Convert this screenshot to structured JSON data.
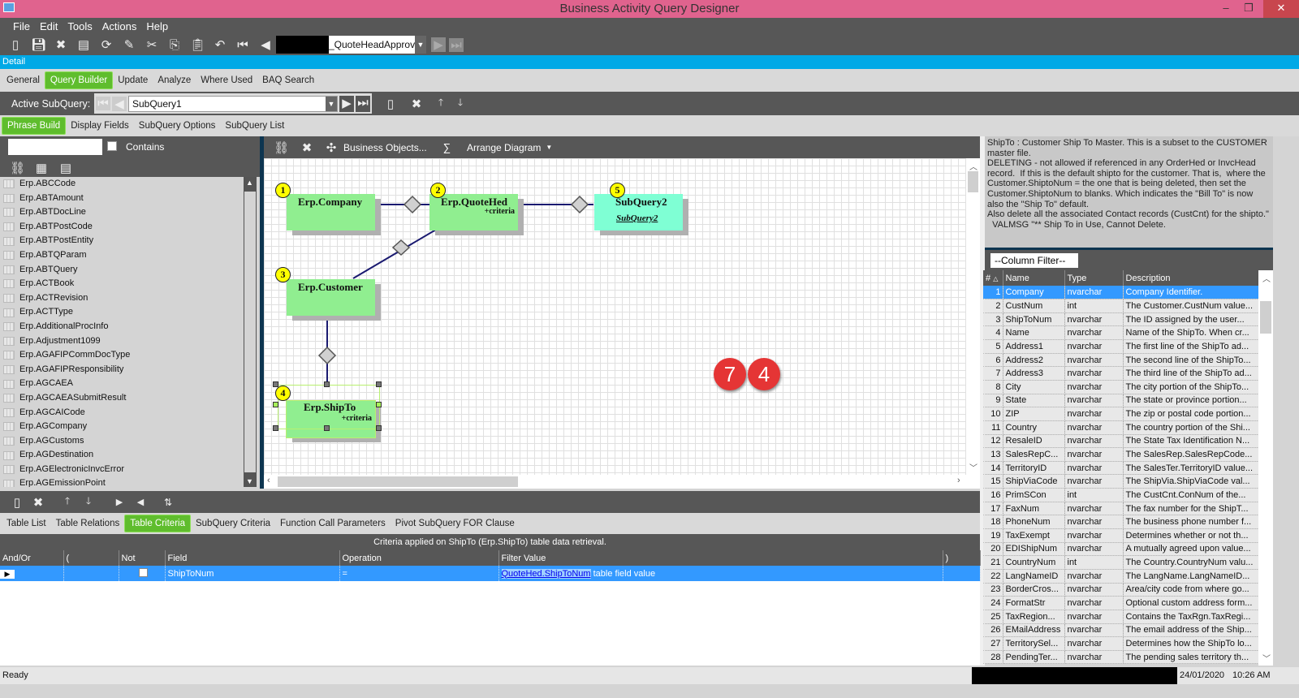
{
  "window": {
    "title": "Business Activity Query Designer"
  },
  "menu": [
    "File",
    "Edit",
    "Tools",
    "Actions",
    "Help"
  ],
  "toolbar": {
    "query_id_suffix": "_QuoteHeadApprov"
  },
  "detail_label": "Detail",
  "main_tabs": [
    {
      "label": "General"
    },
    {
      "label": "Query Builder",
      "active": true
    },
    {
      "label": "Update"
    },
    {
      "label": "Analyze"
    },
    {
      "label": "Where Used"
    },
    {
      "label": "BAQ Search"
    }
  ],
  "subquery": {
    "label": "Active SubQuery:",
    "value": "SubQuery1"
  },
  "sub_tabs": [
    {
      "label": "Phrase Build",
      "active": true
    },
    {
      "label": "Display Fields"
    },
    {
      "label": "SubQuery Options"
    },
    {
      "label": "SubQuery List"
    }
  ],
  "left_panel": {
    "search_value": "",
    "contains_label": "Contains",
    "contains_checked": false,
    "tables": [
      "Erp.ABCCode",
      "Erp.ABTAmount",
      "Erp.ABTDocLine",
      "Erp.ABTPostCode",
      "Erp.ABTPostEntity",
      "Erp.ABTQParam",
      "Erp.ABTQuery",
      "Erp.ACTBook",
      "Erp.ACTRevision",
      "Erp.ACTType",
      "Erp.AdditionalProcInfo",
      "Erp.Adjustment1099",
      "Erp.AGAFIPCommDocType",
      "Erp.AGAFIPResponsibility",
      "Erp.AGCAEA",
      "Erp.AGCAEASubmitResult",
      "Erp.AGCAICode",
      "Erp.AGCompany",
      "Erp.AGCustoms",
      "Erp.AGDestination",
      "Erp.AGElectronicInvcError",
      "Erp.AGEmissionPoint"
    ]
  },
  "diagram_toolbar": {
    "business_objects": "Business Objects...",
    "sigma": "∑",
    "arrange": "Arrange Diagram"
  },
  "diagram": {
    "nodes": [
      {
        "num": "1",
        "title": "Erp.Company",
        "criteria": "",
        "color": "#90ee90"
      },
      {
        "num": "2",
        "title": "Erp.QuoteHed",
        "criteria": "+criteria",
        "color": "#90ee90"
      },
      {
        "num": "5",
        "title": "SubQuery2",
        "subtitle": "SubQuery2",
        "color": "#7fffd4"
      },
      {
        "num": "3",
        "title": "Erp.Customer",
        "criteria": "",
        "color": "#90ee90"
      },
      {
        "num": "4",
        "title": "Erp.ShipTo",
        "criteria": "+criteria",
        "color": "#90ee90",
        "selected": true
      }
    ],
    "badges": [
      "7",
      "4"
    ]
  },
  "description": "ShipTo : Customer Ship To Master. This is a subset to the CUSTOMER master file.\nDELETING - not allowed if referenced in any OrderHed or InvcHead record.  If this is the default shipto for the customer. That is,  where the Customer.ShiptoNum = the one that is being deleted, then set the Customer.ShiptoNum to blanks. Which indicates the \"Bill To\" is now also the \"Ship To\" default.\nAlso delete all the associated Contact records (CustCnt) for the shipto.\"\n  VALMSG \"** Ship To in Use, Cannot Delete.",
  "column_filter": {
    "value": "--Column Filter--"
  },
  "columns_grid": {
    "headers": [
      "#",
      "Name",
      "Type",
      "Description"
    ],
    "rows": [
      [
        "1",
        "Company",
        "nvarchar",
        "Company Identifier."
      ],
      [
        "2",
        "CustNum",
        "int",
        "The Customer.CustNum value..."
      ],
      [
        "3",
        "ShipToNum",
        "nvarchar",
        "The ID assigned by the user..."
      ],
      [
        "4",
        "Name",
        "nvarchar",
        "Name of the ShipTo. When cr..."
      ],
      [
        "5",
        "Address1",
        "nvarchar",
        "The first line of the ShipTo ad..."
      ],
      [
        "6",
        "Address2",
        "nvarchar",
        "The second line of the ShipTo..."
      ],
      [
        "7",
        "Address3",
        "nvarchar",
        "The third line of the ShipTo ad..."
      ],
      [
        "8",
        "City",
        "nvarchar",
        "The city portion of the ShipTo..."
      ],
      [
        "9",
        "State",
        "nvarchar",
        "The state or province portion..."
      ],
      [
        "10",
        "ZIP",
        "nvarchar",
        "The zip or postal code portion..."
      ],
      [
        "11",
        "Country",
        "nvarchar",
        "The country portion of the Shi..."
      ],
      [
        "12",
        "ResaleID",
        "nvarchar",
        "The State Tax Identification N..."
      ],
      [
        "13",
        "SalesRepC...",
        "nvarchar",
        "The SalesRep.SalesRepCode..."
      ],
      [
        "14",
        "TerritoryID",
        "nvarchar",
        "The SalesTer.TerritoryID value..."
      ],
      [
        "15",
        "ShipViaCode",
        "nvarchar",
        "The ShipVia.ShipViaCode val..."
      ],
      [
        "16",
        "PrimSCon",
        "int",
        "The CustCnt.ConNum of the..."
      ],
      [
        "17",
        "FaxNum",
        "nvarchar",
        "The fax number for the ShipT..."
      ],
      [
        "18",
        "PhoneNum",
        "nvarchar",
        "The business phone number f..."
      ],
      [
        "19",
        "TaxExempt",
        "nvarchar",
        "Determines whether or not th..."
      ],
      [
        "20",
        "EDIShipNum",
        "nvarchar",
        "A mutually agreed upon value..."
      ],
      [
        "21",
        "CountryNum",
        "int",
        "The Country.CountryNum valu..."
      ],
      [
        "22",
        "LangNameID",
        "nvarchar",
        "The LangName.LangNameID..."
      ],
      [
        "23",
        "BorderCros...",
        "nvarchar",
        "Area/city code from where go..."
      ],
      [
        "24",
        "FormatStr",
        "nvarchar",
        "Optional custom address form..."
      ],
      [
        "25",
        "TaxRegion...",
        "nvarchar",
        "Contains the TaxRgn.TaxRegi..."
      ],
      [
        "26",
        "EMailAddress",
        "nvarchar",
        "The email address of the Ship..."
      ],
      [
        "27",
        "TerritorySel...",
        "nvarchar",
        "Determines how the ShipTo lo..."
      ],
      [
        "28",
        "PendingTer...",
        "nvarchar",
        "The pending sales territory th..."
      ]
    ]
  },
  "bottom_tabs": [
    {
      "label": "Table List"
    },
    {
      "label": "Table Relations"
    },
    {
      "label": "Table Criteria",
      "active": true
    },
    {
      "label": "SubQuery Criteria"
    },
    {
      "label": "Function Call Parameters"
    },
    {
      "label": "Pivot SubQuery FOR Clause"
    }
  ],
  "criteria": {
    "caption": "Criteria applied on ShipTo (Erp.ShipTo) table data retrieval.",
    "headers": [
      "And/Or",
      "(",
      "Not",
      "Field",
      "Operation",
      "Filter Value",
      ")"
    ],
    "rows": [
      {
        "and_or": "",
        "paren_open": "",
        "not": false,
        "field": "ShipToNum",
        "operation": "=",
        "filter_link": "QuoteHed.ShipToNum",
        "filter_suffix": "table field value",
        "paren_close": ""
      }
    ]
  },
  "status": {
    "text": "Ready",
    "date": "24/01/2020",
    "time": "10:26 AM"
  },
  "colors": {
    "title_bar": "#e0638e",
    "accent_blue": "#00a9e6",
    "active_tab": "#5fbd2d",
    "selection": "#3399ff",
    "badge": "#e53535"
  }
}
